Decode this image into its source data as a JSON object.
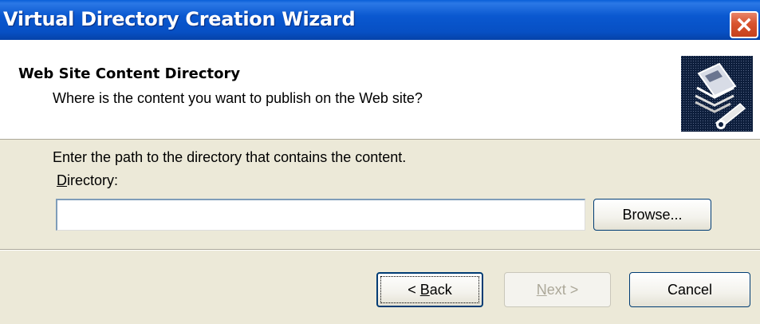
{
  "window": {
    "title": "Virtual Directory Creation Wizard"
  },
  "header": {
    "title": "Web Site Content Directory",
    "subtitle": "Where is the content you want to publish on the Web site?",
    "icon": "book-pen-icon"
  },
  "body": {
    "instruction": "Enter the path to the directory that contains the content.",
    "directory_label_mnemonic": "D",
    "directory_label_rest": "irectory:",
    "directory_value": "",
    "browse_label": "Browse..."
  },
  "footer": {
    "back_prefix": "< ",
    "back_mnemonic": "B",
    "back_rest": "ack",
    "next_mnemonic": "N",
    "next_rest": "ext >",
    "cancel_label": "Cancel"
  },
  "colors": {
    "titlebar": "#0a58d0",
    "close": "#d8532e",
    "dialog_bg": "#ece9d8",
    "button_border": "#003c74",
    "disabled_text": "#aca899"
  }
}
